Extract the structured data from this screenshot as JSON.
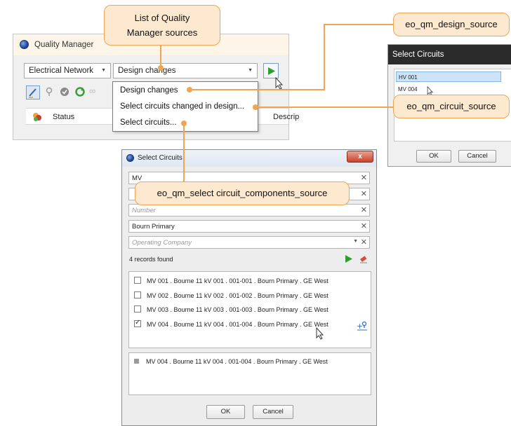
{
  "callouts": {
    "list_sources": "List of Quality Manager sources",
    "design_source": "eo_qm_design_source",
    "circuit_source": "eo_qm_circuit_source",
    "components_source": "eo_qm_select circuit_components_source"
  },
  "quality_manager": {
    "title": "Quality Manager",
    "network_combo": "Electrical Network",
    "source_combo": "Design changes",
    "grid_columns": [
      "Status",
      "Descrip"
    ]
  },
  "source_dropdown": {
    "items": [
      "Design changes",
      "Select circuits changed in design...",
      "Select circuits..."
    ]
  },
  "small_select_circuits": {
    "title": "Select Circuits",
    "rows": [
      "HV 001",
      "MV 004"
    ],
    "ok_label": "OK",
    "cancel_label": "Cancel"
  },
  "select_circuits_dialog": {
    "title": "Select Circuits",
    "close_label": "x",
    "fields": {
      "circuit_value": "MV",
      "number_placeholder": "Number",
      "substation_value": "Bourn Primary",
      "company_placeholder": "Operating Company"
    },
    "records_found": "4 records found",
    "records": [
      {
        "label": "MV 001 . Bourne 11 kV 001 . 001-001 . Bourn Primary . GE West",
        "checked": false
      },
      {
        "label": "MV 002 . Bourne 11 kV 002 . 001-002 . Bourn Primary . GE West",
        "checked": false
      },
      {
        "label": "MV 003 . Bourne 11 kV 003 . 001-003 . Bourn Primary . GE West",
        "checked": false
      },
      {
        "label": "MV 004 . Bourne 11 kV 004 . 001-004 . Bourn Primary . GE West",
        "checked": true
      }
    ],
    "selected": [
      "MV 004 . Bourne 11 kV 004 . 001-004 . Bourn Primary . GE West"
    ],
    "ok_label": "OK",
    "cancel_label": "Cancel"
  },
  "colors": {
    "callout_fill": "#fde9cf",
    "callout_border": "#f0a552",
    "run_green": "#2e9e2e"
  }
}
